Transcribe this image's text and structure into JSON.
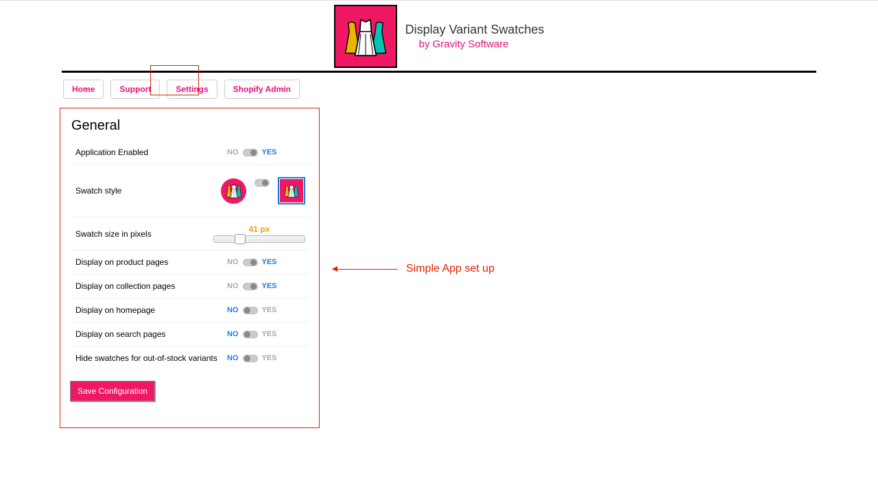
{
  "header": {
    "title": "Display Variant Swatches",
    "by": "by Gravity Software"
  },
  "nav": {
    "items": [
      "Home",
      "Support",
      "Settings",
      "Shopify Admin"
    ]
  },
  "panel": {
    "title": "General",
    "rows": {
      "appEnabled": {
        "label": "Application Enabled",
        "no": "NO",
        "yes": "YES"
      },
      "swatchStyle": {
        "label": "Swatch style"
      },
      "swatchSize": {
        "label": "Swatch size in pixels",
        "value": "41 px"
      },
      "productPages": {
        "label": "Display on product pages",
        "no": "NO",
        "yes": "YES"
      },
      "collectionPages": {
        "label": "Display on collection pages",
        "no": "NO",
        "yes": "YES"
      },
      "homepage": {
        "label": "Display on homepage",
        "no": "NO",
        "yes": "YES"
      },
      "searchPages": {
        "label": "Display on search pages",
        "no": "NO",
        "yes": "YES"
      },
      "hideOOS": {
        "label": "Hide swatches for out-of-stock variants",
        "no": "NO",
        "yes": "YES"
      }
    },
    "saveLabel": "Save Configuration"
  },
  "annotation": "Simple App set up"
}
